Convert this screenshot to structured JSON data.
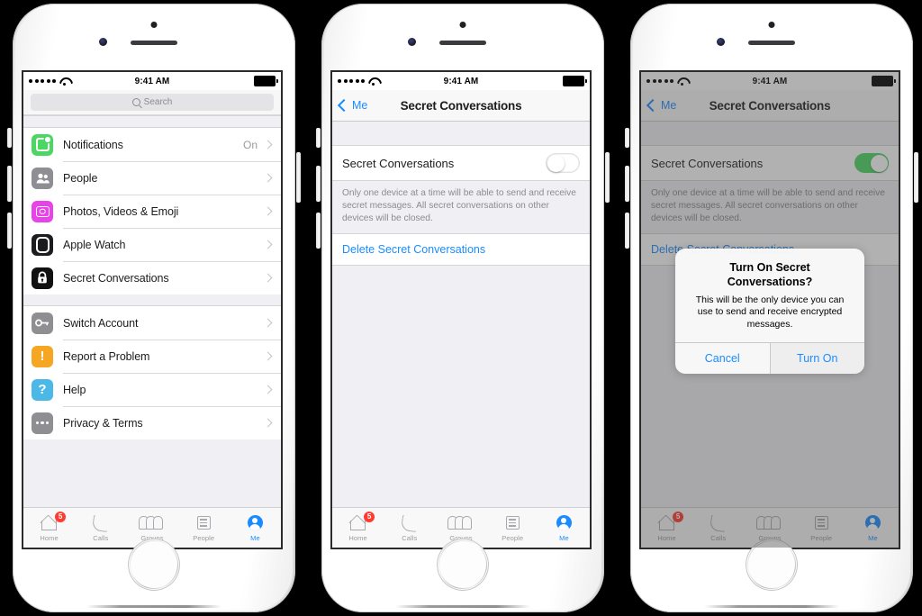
{
  "status_bar": {
    "time": "9:41 AM",
    "signal_dots": 5,
    "wifi_icon": "wifi-icon",
    "battery_icon": "battery-full-icon"
  },
  "tabbar": {
    "items": [
      {
        "label": "Home",
        "icon": "home-icon",
        "badge": "5",
        "active": false
      },
      {
        "label": "Calls",
        "icon": "phone-icon",
        "badge": "",
        "active": false
      },
      {
        "label": "Groups",
        "icon": "groups-icon",
        "badge": "",
        "active": false
      },
      {
        "label": "People",
        "icon": "people-list-icon",
        "badge": "",
        "active": false
      },
      {
        "label": "Me",
        "icon": "avatar-icon",
        "badge": "",
        "active": true
      }
    ]
  },
  "phone1": {
    "search": {
      "placeholder": "Search",
      "icon": "search-icon"
    },
    "groups": [
      {
        "rows": [
          {
            "label": "Notifications",
            "value": "On",
            "icon": "notifications-icon"
          },
          {
            "label": "People",
            "value": "",
            "icon": "people-icon"
          },
          {
            "label": "Photos, Videos & Emoji",
            "value": "",
            "icon": "camera-icon"
          },
          {
            "label": "Apple Watch",
            "value": "",
            "icon": "apple-watch-icon"
          },
          {
            "label": "Secret Conversations",
            "value": "",
            "icon": "lock-icon"
          }
        ]
      },
      {
        "rows": [
          {
            "label": "Switch Account",
            "value": "",
            "icon": "key-icon"
          },
          {
            "label": "Report a Problem",
            "value": "",
            "icon": "warning-icon"
          },
          {
            "label": "Help",
            "value": "",
            "icon": "question-icon"
          },
          {
            "label": "Privacy & Terms",
            "value": "",
            "icon": "ellipsis-icon"
          }
        ]
      }
    ]
  },
  "phone2": {
    "nav": {
      "back_label": "Me",
      "back_icon": "chevron-left-icon",
      "title": "Secret Conversations"
    },
    "toggle_row": {
      "label": "Secret Conversations",
      "state": "off"
    },
    "description": "Only one device at a time will be able to send and receive secret messages. All secret conversations on other devices will be closed.",
    "delete_link": "Delete Secret Conversations"
  },
  "phone3": {
    "nav": {
      "back_label": "Me",
      "back_icon": "chevron-left-icon",
      "title": "Secret Conversations"
    },
    "toggle_row": {
      "label": "Secret Conversations",
      "state": "on"
    },
    "description": "Only one device at a time will be able to send and receive secret messages. All secret conversations on other devices will be closed.",
    "delete_link": "Delete Secret Conversations",
    "alert": {
      "title": "Turn On Secret Conversations?",
      "message": "This will be the only device you can use to send and receive encrypted messages.",
      "cancel_label": "Cancel",
      "confirm_label": "Turn On"
    }
  },
  "colors": {
    "accent_blue": "#1a8cff",
    "toggle_on_green": "#4cd763",
    "badge_red": "#ff3b30",
    "notifications_green": "#4cd763",
    "photos_magenta": "#e843e8",
    "report_orange": "#f5a623",
    "help_blue": "#4cb8e8",
    "gray_icon": "#8e8e93",
    "list_bg": "#efeff4"
  }
}
